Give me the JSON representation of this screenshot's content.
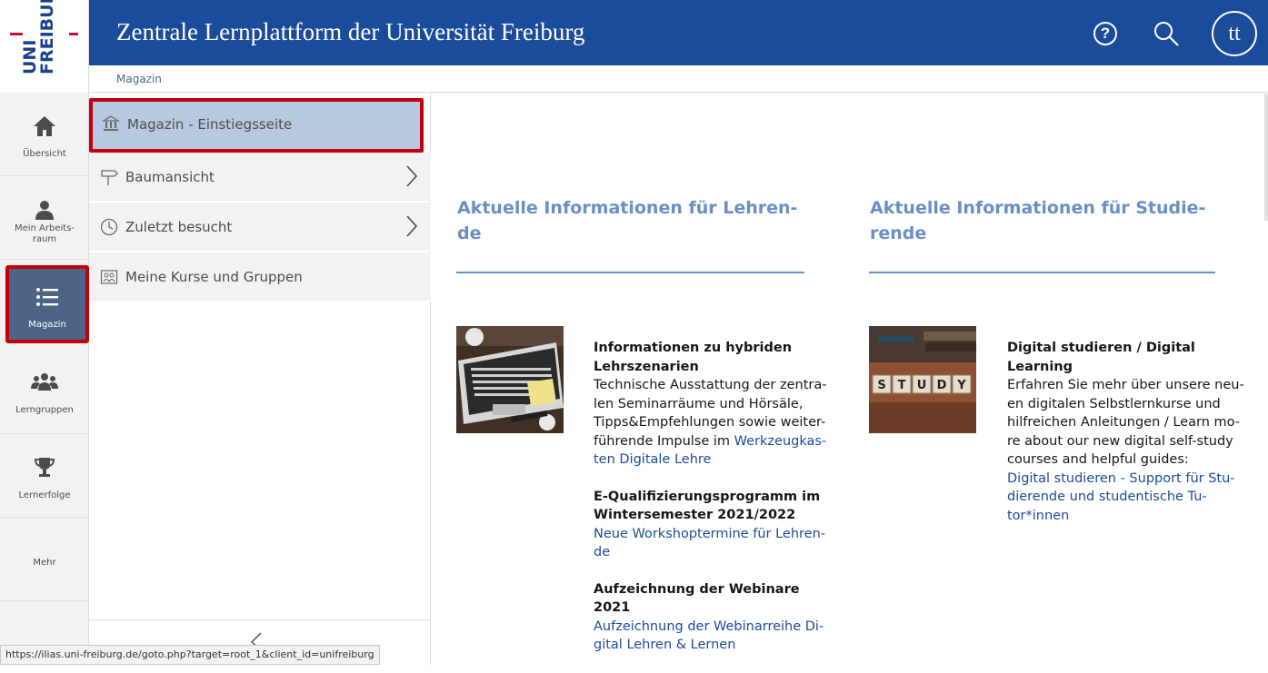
{
  "logo": {
    "line1": "UNI",
    "line2": "FREIBURG"
  },
  "header": {
    "title": "Zentrale Lernplattform der Universität Freiburg",
    "help_glyph": "?",
    "avatar_initials": "tt",
    "background": "#1b4b9b"
  },
  "breadcrumb": {
    "item": "Magazin"
  },
  "mainbar": {
    "items": [
      {
        "label": "Übersicht",
        "icon": "home-icon"
      },
      {
        "label": "Mein Arbeits-\nraum",
        "icon": "user-icon"
      },
      {
        "label": "Magazin",
        "icon": "list-icon",
        "active": true
      },
      {
        "label": "Lerngruppen",
        "icon": "groups-icon"
      },
      {
        "label": "Lernerfolge",
        "icon": "trophy-icon"
      },
      {
        "label": "Mehr",
        "icon": ""
      }
    ],
    "active_color": "#4c6586",
    "highlight_color": "#c0000d"
  },
  "slate": {
    "items": [
      {
        "label": "Magazin - Einstiegsseite",
        "icon": "repository-icon",
        "selected": true
      },
      {
        "label": "Baumansicht",
        "icon": "signpost-icon",
        "has_submenu": true
      },
      {
        "label": "Zuletzt besucht",
        "icon": "clock-icon",
        "has_submenu": true
      },
      {
        "label": "Meine Kurse und Gruppen",
        "icon": "courses-icon"
      }
    ]
  },
  "status_url": "https://ilias.uni-freiburg.de/goto.php?target=root_1&client_id=unifreiburg",
  "content": {
    "left": {
      "heading_l1": "Aktuelle Informationen für Lehren-",
      "heading_l2": "de",
      "image": "laptop-desk-photo",
      "news": [
        {
          "title_l1": "Informationen zu hybriden",
          "title_l2": "Lehrszenarien",
          "body": [
            "Technische Ausstattung der zentra-",
            "len Seminarräume und Hörsäle,",
            "Tipps&Empfehlungen sowie weiter-",
            "führende Impulse im "
          ],
          "link_inline": "Werkzeugkas-",
          "link_l2": "ten Digitale Lehre"
        },
        {
          "title_l1": "E-Qualifizierungsprogramm im",
          "title_l2": "Wintersemester 2021/2022",
          "link_l1": "Neue Workshoptermine für Lehren-",
          "link_l2": "de"
        },
        {
          "title_l1": "Aufzeichnung der Webinare 2021",
          "link_l1": "Aufzeichnung der Webinarreihe Di-",
          "link_l2": "gital Lehren & Lernen"
        }
      ]
    },
    "right": {
      "heading_l1": "Aktuelle Informationen für Studie-",
      "heading_l2": "rende",
      "image": "study-dice-photo",
      "image_word": [
        "S",
        "T",
        "U",
        "D",
        "Y"
      ],
      "news": [
        {
          "title_l1": "Digital studieren / Digital",
          "title_l2": "Learning",
          "body": [
            "Erfahren Sie mehr über unsere neu-",
            "en digitalen Selbstlernkurse und",
            "hilfreichen Anleitungen / Learn mo-",
            "re about our new digital self-study",
            "courses and helpful guides:"
          ],
          "link_l1": "Digital studieren - Support für Stu-",
          "link_l2": "dierende und studentische Tu-",
          "link_l3": "tor*innen"
        }
      ]
    },
    "heading_color": "#6a8fc4",
    "link_color": "#1b4b9b"
  }
}
